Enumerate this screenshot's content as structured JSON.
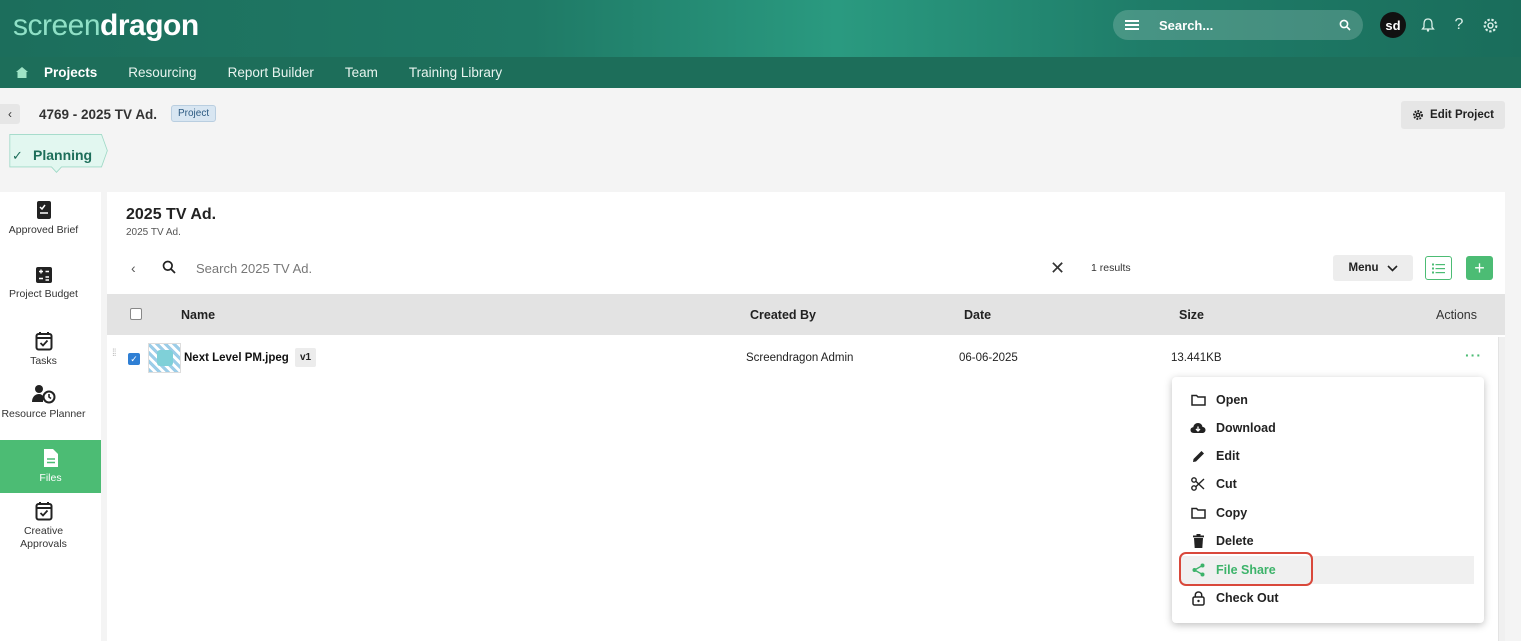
{
  "brand": {
    "logo_part1": "screen",
    "logo_part2": "dragon"
  },
  "topbar": {
    "search_placeholder": "Search...",
    "avatar_initials": "sd"
  },
  "nav": {
    "items": [
      "Projects",
      "Resourcing",
      "Report Builder",
      "Team",
      "Training Library"
    ],
    "active": "Projects"
  },
  "project": {
    "title": "4769 - 2025 TV Ad.",
    "tag": "Project",
    "edit_label": "Edit Project",
    "stage": "Planning"
  },
  "rail": {
    "items": [
      {
        "label": "Approved Brief",
        "icon": "document-check-icon"
      },
      {
        "label": "Project Budget",
        "icon": "calculator-icon"
      },
      {
        "label": "Tasks",
        "icon": "calendar-check-icon"
      },
      {
        "label": "Resource Planner",
        "icon": "person-clock-icon"
      },
      {
        "label": "Files",
        "icon": "file-icon",
        "active": true
      },
      {
        "label": "Creative Approvals",
        "icon": "calendar-check-icon"
      }
    ]
  },
  "panel": {
    "title": "2025 TV Ad.",
    "subtitle": "2025 TV Ad.",
    "search_placeholder": "Search 2025 TV Ad.",
    "results": "1 results",
    "menu_label": "Menu"
  },
  "table": {
    "headers": {
      "name": "Name",
      "created_by": "Created By",
      "date": "Date",
      "size": "Size",
      "actions": "Actions"
    },
    "rows": [
      {
        "name": "Next Level PM.jpeg",
        "version": "v1",
        "created_by": "Screendragon Admin",
        "date": "06-06-2025",
        "size": "13.441KB",
        "checked": true
      }
    ]
  },
  "context_menu": {
    "items": [
      "Open",
      "Download",
      "Edit",
      "Cut",
      "Copy",
      "Delete",
      "File Share",
      "Check Out"
    ],
    "highlighted": "File Share"
  },
  "colors": {
    "brand_green": "#4cbc74",
    "nav_green": "#1d6e5a",
    "highlight_ring": "#d9483b"
  }
}
